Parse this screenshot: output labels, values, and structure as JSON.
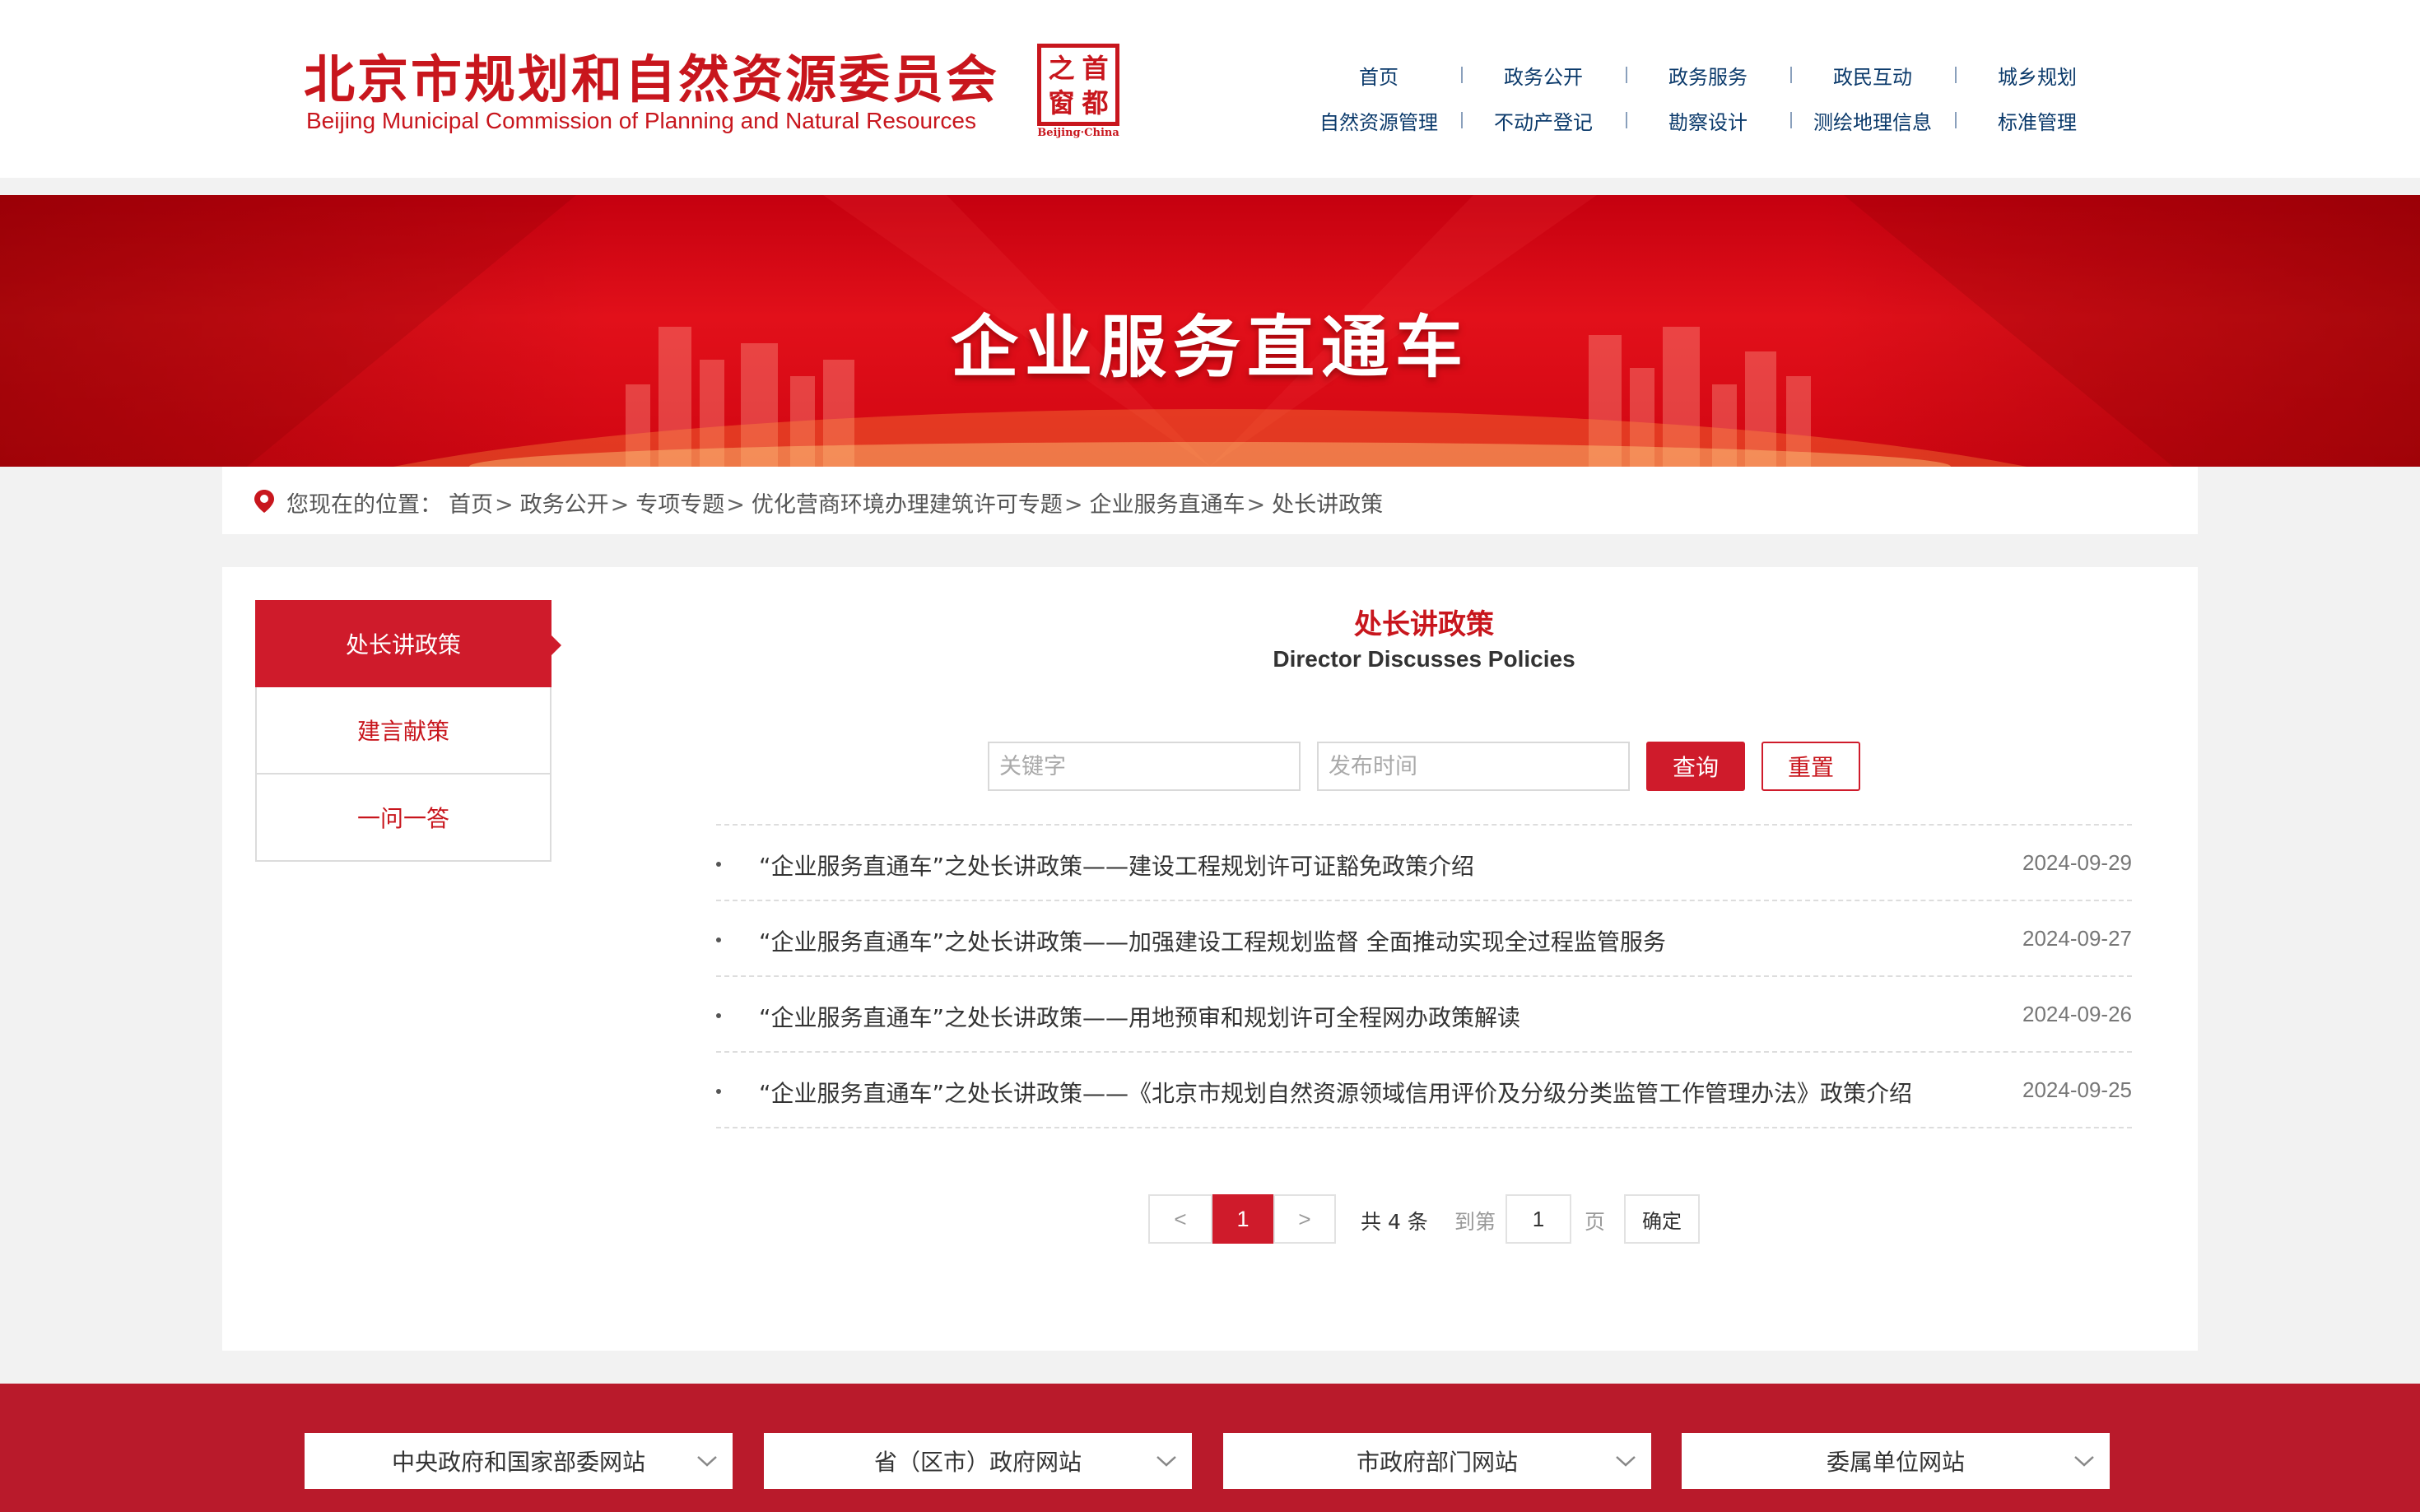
{
  "header": {
    "title_cn": "北京市规划和自然资源委员会",
    "title_en": "Beijing Municipal Commission of Planning and Natural Resources",
    "seal": {
      "chars": [
        "之",
        "首",
        "窗",
        "都"
      ],
      "caption": "Beijing·China"
    }
  },
  "nav": {
    "row1": [
      "首页",
      "政务公开",
      "政务服务",
      "政民互动",
      "城乡规划"
    ],
    "row2": [
      "自然资源管理",
      "不动产登记",
      "勘察设计",
      "测绘地理信息",
      "标准管理"
    ]
  },
  "banner": {
    "title": "企业服务直通车"
  },
  "breadcrumb": {
    "prefix": "您现在的位置：",
    "items": [
      "首页",
      "政务公开",
      "专项专题",
      "优化营商环境办理建筑许可专题",
      "企业服务直通车",
      "处长讲政策"
    ],
    "separator": ">"
  },
  "sidebar": {
    "items": [
      {
        "label": "处长讲政策",
        "active": true
      },
      {
        "label": "建言献策",
        "active": false
      },
      {
        "label": "一问一答",
        "active": false
      }
    ]
  },
  "content": {
    "title": "处长讲政策",
    "subtitle": "Director Discusses Policies",
    "search": {
      "keyword_placeholder": "关键字",
      "date_placeholder": "发布时间",
      "query_label": "查询",
      "reset_label": "重置"
    },
    "articles": [
      {
        "title": "“企业服务直通车”之处长讲政策——建设工程规划许可证豁免政策介绍",
        "date": "2024-09-29"
      },
      {
        "title": "“企业服务直通车”之处长讲政策——加强建设工程规划监督 全面推动实现全过程监管服务",
        "date": "2024-09-27"
      },
      {
        "title": "“企业服务直通车”之处长讲政策——用地预审和规划许可全程网办政策解读",
        "date": "2024-09-26"
      },
      {
        "title": "“企业服务直通车”之处长讲政策——《北京市规划自然资源领域信用评价及分级分类监管工作管理办法》政策介绍",
        "date": "2024-09-25"
      }
    ],
    "pagination": {
      "prev": "<",
      "next": ">",
      "current_page": "1",
      "total_text": "共 4 条",
      "goto_label": "到第",
      "goto_value": "1",
      "page_unit": "页",
      "confirm_label": "确定"
    }
  },
  "footer": {
    "selects": [
      "中央政府和国家部委网站",
      "省（区市）政府网站",
      "市政府部门网站",
      "委属单位网站"
    ]
  },
  "colors": {
    "brand_red": "#c8161d",
    "accent_red": "#cf1b2b",
    "footer_red": "#b91a2b",
    "nav_blue": "#0b3a6b"
  }
}
